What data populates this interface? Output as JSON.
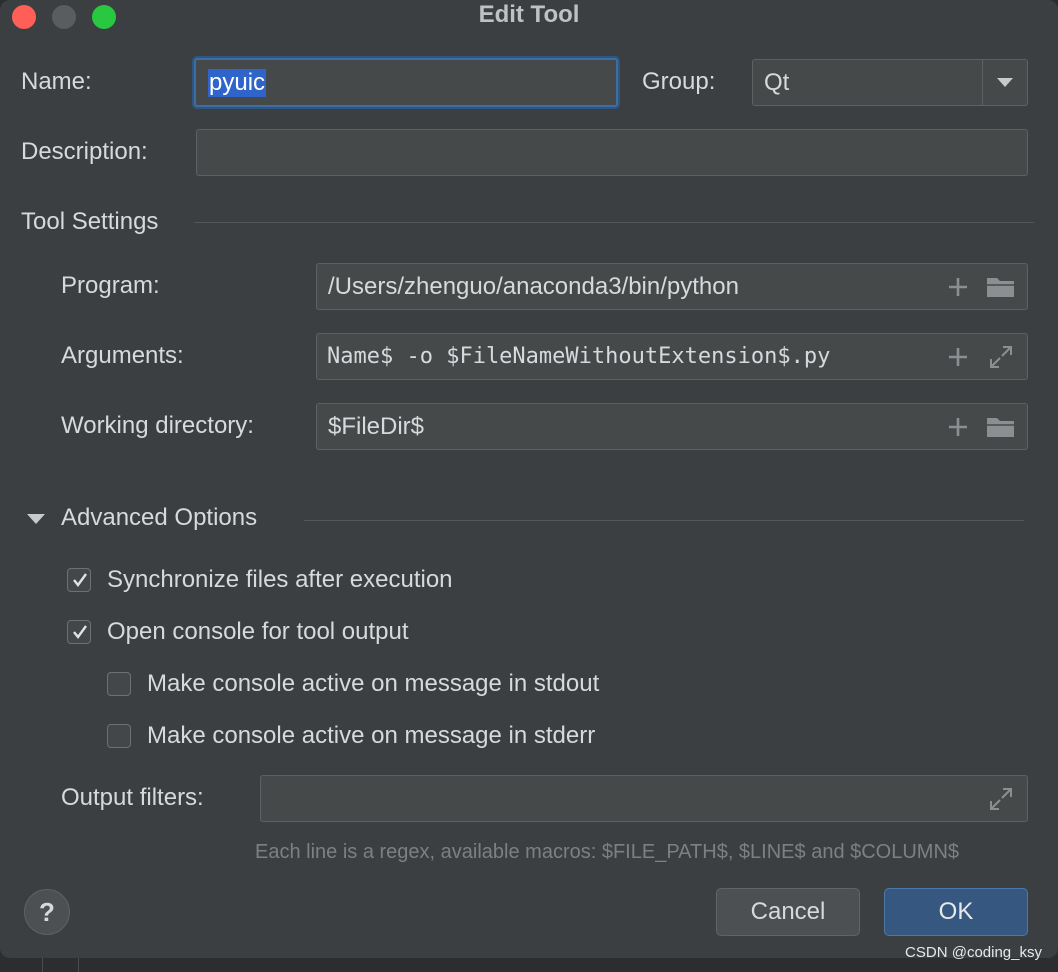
{
  "window": {
    "title": "Edit Tool"
  },
  "form": {
    "name_label": "Name:",
    "name_value": "pyuic",
    "group_label": "Group:",
    "group_value": "Qt",
    "description_label": "Description:",
    "description_value": ""
  },
  "tool_settings": {
    "section_label": "Tool Settings",
    "program_label": "Program:",
    "program_value": "/Users/zhenguo/anaconda3/bin/python",
    "arguments_label": "Arguments:",
    "arguments_value": "Name$ -o $FileNameWithoutExtension$.py",
    "working_dir_label": "Working directory:",
    "working_dir_value": "$FileDir$"
  },
  "advanced": {
    "section_label": "Advanced Options",
    "expanded": true,
    "options": [
      {
        "label": "Synchronize files after execution",
        "checked": true
      },
      {
        "label": "Open console for tool output",
        "checked": true
      },
      {
        "label": "Make console active on message in stdout",
        "checked": false
      },
      {
        "label": "Make console active on message in stderr",
        "checked": false
      }
    ],
    "output_filters_label": "Output filters:",
    "output_filters_value": "",
    "hint": "Each line is a regex, available macros: $FILE_PATH$, $LINE$ and $COLUMN$"
  },
  "buttons": {
    "help": "?",
    "cancel": "Cancel",
    "ok": "OK"
  },
  "icons": {
    "add": "plus-icon",
    "browse": "folder-icon",
    "expand": "expand-icon",
    "dropdown": "chevron-down-icon",
    "section_toggle": "triangle-down-icon",
    "check": "checkmark-icon"
  },
  "colors": {
    "window_bg": "#3c3f41",
    "field_bg": "#45494a",
    "focus_border": "#3b6ea5",
    "selection": "#2f65ca",
    "ok_button": "#365880",
    "close": "#ff5f57",
    "minimize": "#5a5c5e",
    "maximize": "#28c840"
  },
  "watermark": "CSDN @coding_ksy"
}
